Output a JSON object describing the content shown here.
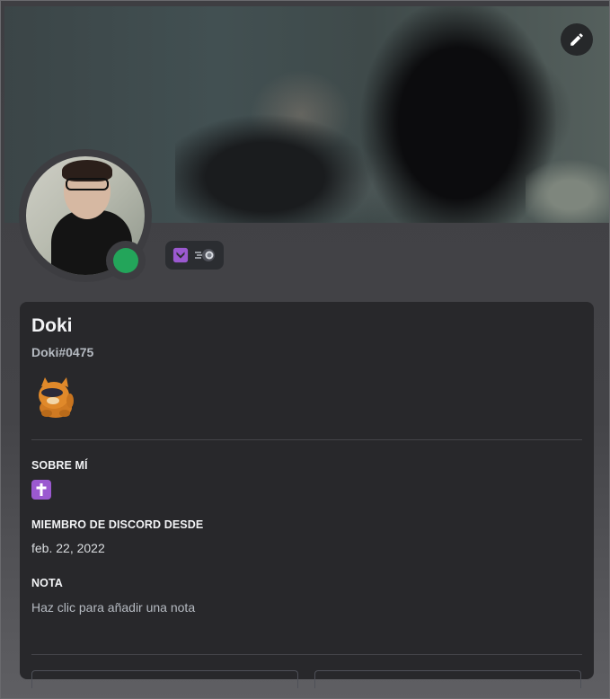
{
  "profile": {
    "display_name": "Doki",
    "username_tag": "Doki#0475",
    "status": "online",
    "status_color": "#23a55a",
    "badges": [
      "nitro-shield-icon",
      "server-boost-icon"
    ]
  },
  "banner": {
    "edit_icon": "pencil-icon"
  },
  "sections": {
    "about_title": "SOBRE MÍ",
    "about_icon": "latin-cross-emoji",
    "member_since_title": "MIEMBRO DE DISCORD DESDE",
    "member_since_value": "feb. 22, 2022",
    "note_title": "NOTA",
    "note_placeholder": "Haz clic para añadir una nota"
  },
  "colors": {
    "card_bg": "#28282b",
    "accent_purple": "#9b59d0",
    "online_green": "#23a55a"
  }
}
